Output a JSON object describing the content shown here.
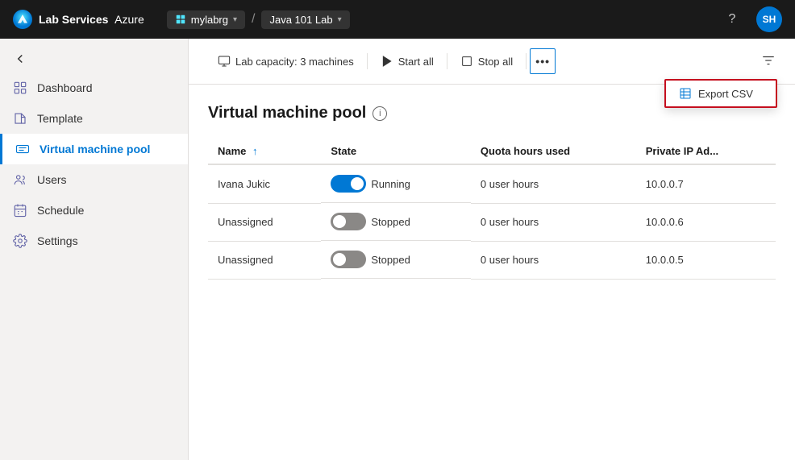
{
  "topbar": {
    "logo_text_normal": "Azure",
    "logo_text_bold": "Lab Services",
    "breadcrumb_icon_label": "resource-group-icon",
    "breadcrumb_rg": "mylabrg",
    "breadcrumb_lab": "Java 101 Lab",
    "help_label": "?",
    "avatar_label": "SH"
  },
  "sidebar": {
    "collapse_label": "Collapse sidebar",
    "items": [
      {
        "id": "dashboard",
        "label": "Dashboard",
        "icon": "dashboard-icon",
        "active": false
      },
      {
        "id": "template",
        "label": "Template",
        "icon": "template-icon",
        "active": false
      },
      {
        "id": "virtual-machine-pool",
        "label": "Virtual machine pool",
        "icon": "vm-pool-icon",
        "active": true
      },
      {
        "id": "users",
        "label": "Users",
        "icon": "users-icon",
        "active": false
      },
      {
        "id": "schedule",
        "label": "Schedule",
        "icon": "schedule-icon",
        "active": false
      },
      {
        "id": "settings",
        "label": "Settings",
        "icon": "settings-icon",
        "active": false
      }
    ]
  },
  "toolbar": {
    "capacity_label": "Lab capacity: 3 machines",
    "start_all_label": "Start all",
    "stop_all_label": "Stop all",
    "more_label": "...",
    "export_csv_label": "Export CSV",
    "filter_label": "Filter"
  },
  "page": {
    "title": "Virtual machine pool",
    "table": {
      "columns": [
        "Name",
        "State",
        "Quota hours used",
        "Private IP Ad..."
      ],
      "rows": [
        {
          "name": "Ivana Jukic",
          "state": "Running",
          "state_on": true,
          "quota": "0 user hours",
          "ip": "10.0.0.7"
        },
        {
          "name": "Unassigned",
          "state": "Stopped",
          "state_on": false,
          "quota": "0 user hours",
          "ip": "10.0.0.6"
        },
        {
          "name": "Unassigned",
          "state": "Stopped",
          "state_on": false,
          "quota": "0 user hours",
          "ip": "10.0.0.5"
        }
      ]
    }
  }
}
